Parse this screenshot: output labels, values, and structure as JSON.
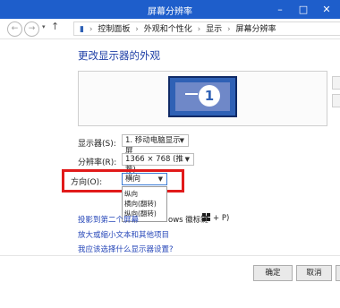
{
  "window": {
    "title": "屏幕分辨率"
  },
  "breadcrumb": {
    "home_glyph": "▮",
    "items": [
      "控制面板",
      "外观和个性化",
      "显示",
      "屏幕分辨率"
    ]
  },
  "heading": "更改显示器的外观",
  "monitor": {
    "number": "1"
  },
  "settings": {
    "display": {
      "label": "显示器(S):",
      "value": "1. 移动电脑显示屏"
    },
    "resolution": {
      "label": "分辨率(R):",
      "value": "1366 × 768 (推荐)"
    },
    "orientation": {
      "label": "方向(O):",
      "value": "横向",
      "options": [
        "纵向",
        "横向(翻转)",
        "纵向(翻转)"
      ]
    }
  },
  "links": {
    "project_a": "投影到第二个屏幕",
    "project_b": "ows 徽标键",
    "project_c": "+ P)",
    "enlarge": "放大或缩小文本和其他项目",
    "help": "我应该选择什么显示器设置?"
  },
  "buttons": {
    "ok": "确定",
    "cancel": "取消"
  },
  "colors": {
    "titlebar": "#1e5ecb",
    "link": "#2546b8",
    "highlight": "#e11a1a"
  }
}
